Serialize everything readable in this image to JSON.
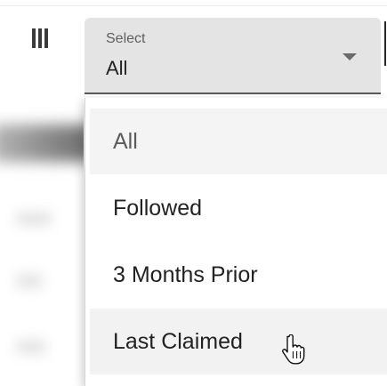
{
  "toolbar": {
    "columns_icon": "columns-icon"
  },
  "select": {
    "label": "Select",
    "value": "All",
    "caret_icon": "caret-down-icon"
  },
  "menu": {
    "items": [
      {
        "label": "All",
        "state": "selected"
      },
      {
        "label": "Followed",
        "state": "normal"
      },
      {
        "label": "3 Months Prior",
        "state": "normal"
      },
      {
        "label": "Last Claimed",
        "state": "hovered"
      }
    ]
  },
  "cursor": {
    "icon": "hand-pointer-icon"
  },
  "colors": {
    "field_background": "#e4e4e4",
    "field_underline": "#5a5a5a",
    "selected_item_background": "#f4f4f4",
    "hover_item_background": "#f2f2f2",
    "text_primary": "#222222",
    "text_muted": "#5f5f5f"
  }
}
